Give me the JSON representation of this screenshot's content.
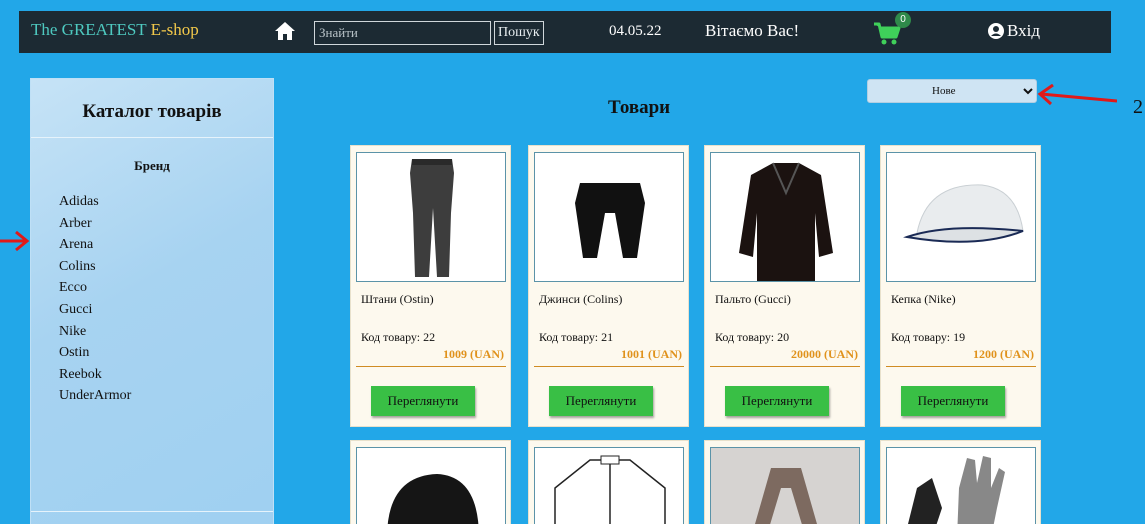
{
  "navbar": {
    "brand_part1": "The GREATEST",
    "brand_part2": "E-shop",
    "search_placeholder": "Знайти",
    "search_button": "Пошук",
    "date": "04.05.22",
    "welcome": "Вітаємо Вас!",
    "cart_count": "0",
    "login": "Вхід"
  },
  "sidebar": {
    "title": "Каталог товарів",
    "brand_heading": "Бренд",
    "brands": [
      "Adidas",
      "Arber",
      "Arena",
      "Colins",
      "Ecco",
      "Gucci",
      "Nike",
      "Ostin",
      "Reebok",
      "UnderArmor"
    ]
  },
  "main": {
    "title": "Товари",
    "sort_selected": "Нове",
    "annotation_label": "2",
    "products": [
      {
        "name": "Штани (Ostin)",
        "code": "Код товару: 22",
        "price": "1009 (UAN)",
        "button": "Переглянути",
        "icon": "pants-icon"
      },
      {
        "name": "Джинси (Colins)",
        "code": "Код товару: 21",
        "price": "1001 (UAN)",
        "button": "Переглянути",
        "icon": "jeans-icon"
      },
      {
        "name": "Пальто (Gucci)",
        "code": "Код товару: 20",
        "price": "20000 (UAN)",
        "button": "Переглянути",
        "icon": "coat-icon"
      },
      {
        "name": "Кепка (Nike)",
        "code": "Код товару: 19",
        "price": "1200 (UAN)",
        "button": "Переглянути",
        "icon": "cap-icon"
      }
    ]
  },
  "colors": {
    "navbar": "#1c2a33",
    "background": "#22a7e8",
    "button": "#39bf45",
    "price": "#e0921c",
    "annotation_arrow": "#e01919"
  }
}
